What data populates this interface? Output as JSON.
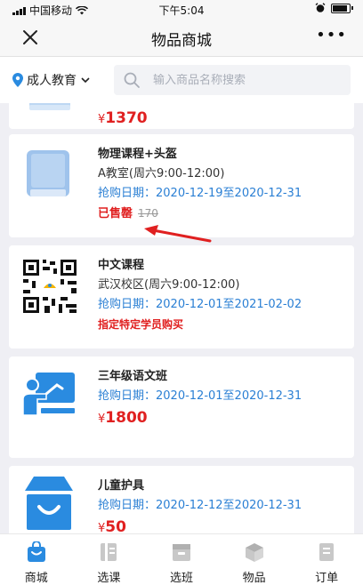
{
  "status_bar": {
    "carrier": "中国移动",
    "time": "下午5:04"
  },
  "nav": {
    "title": "物品商城"
  },
  "filter": {
    "location": "成人教育",
    "search_placeholder": "输入商品名称搜索"
  },
  "items": [
    {
      "price_symbol": "¥",
      "price": "1370"
    },
    {
      "name": "物理课程+头盔",
      "location": "A教室(周六9:00-12:00)",
      "date": "抢购日期：2020-12-19至2020-12-31",
      "status": "已售罄",
      "original_price": "170"
    },
    {
      "name": "中文课程",
      "location": "武汉校区(周六9:00-12:00)",
      "date": "抢购日期：2020-12-01至2021-02-02",
      "restriction": "指定特定学员购买"
    },
    {
      "name": "三年级语文班",
      "date": "抢购日期：2020-12-01至2020-12-31",
      "price_symbol": "¥",
      "price": "1800"
    },
    {
      "name": "儿童护具",
      "date": "抢购日期：2020-12-12至2020-12-31",
      "price_symbol": "¥",
      "price": "50"
    }
  ],
  "tabs": [
    {
      "label": "商城",
      "icon": "shopping-bag-icon",
      "active": true
    },
    {
      "label": "选课",
      "icon": "course-icon",
      "active": false
    },
    {
      "label": "选班",
      "icon": "class-icon",
      "active": false
    },
    {
      "label": "物品",
      "icon": "box-icon",
      "active": false
    },
    {
      "label": "订单",
      "icon": "order-icon",
      "active": false
    }
  ],
  "colors": {
    "accent": "#2a8be0",
    "price_red": "#e02020",
    "date_blue": "#2a7fd4",
    "tab_inactive": "#c8c8c8"
  }
}
